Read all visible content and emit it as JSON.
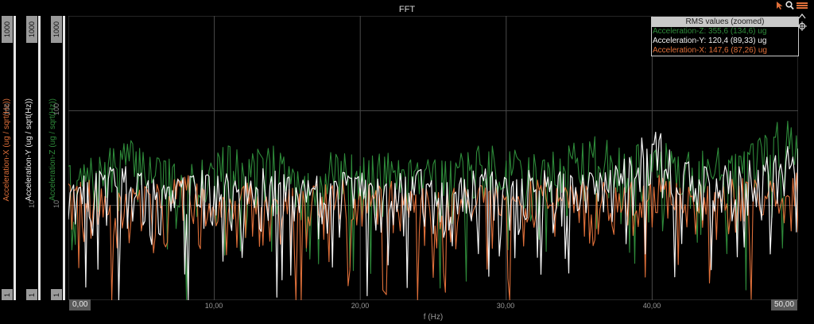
{
  "title": "FFT",
  "colors": {
    "x": "#e0703a",
    "y": "#f2f2f2",
    "z": "#2e8b3a",
    "grid": "#4a4a4a",
    "tag_bg": "#9a9a9a"
  },
  "axes": [
    {
      "id": "x",
      "label": "Acceleration-X (ug / sqrt(Hz))",
      "ticks": [
        "1000",
        "1"
      ]
    },
    {
      "id": "y",
      "label": "Acceleration-Y (ug / sqrt(Hz))",
      "ticks": [
        "1000",
        "1"
      ]
    },
    {
      "id": "z",
      "label": "Acceleration-Z (ug / sqrt(Hz))",
      "ticks": [
        "1000",
        "1"
      ]
    }
  ],
  "inner_ticks": [
    "100",
    "10"
  ],
  "xaxis": {
    "label": "f (Hz)",
    "min_label": "0,00",
    "max_label": "50,00",
    "ticks": [
      "10,00",
      "20,00",
      "30,00",
      "40,00"
    ]
  },
  "legend": {
    "header": "RMS values (zoomed)",
    "rows": [
      {
        "text": "Acceleration-Z: 355,6 (134,6) ug",
        "color": "#2e8b3a"
      },
      {
        "text": "Acceleration-Y: 120,4 (89,33) ug",
        "color": "#f2f2f2"
      },
      {
        "text": "Acceleration-X: 147,6 (87,26) ug",
        "color": "#e0703a"
      }
    ]
  },
  "toolbar": {
    "pointer_icon": "cursor-arrow-icon",
    "zoom_icon": "magnifier-icon",
    "menu_icon": "menu-icon",
    "up_icon": "chevron-up-icon",
    "crosshair_icon": "crosshair-icon"
  },
  "chart_data": {
    "type": "line",
    "title": "FFT",
    "xlabel": "f (Hz)",
    "ylabel": "",
    "xlim": [
      0,
      50
    ],
    "ylim": [
      1,
      1000
    ],
    "yscale": "log",
    "grid": true,
    "legend_position": "top-right",
    "series": [
      {
        "name": "Acceleration-Z",
        "color": "#2e8b3a",
        "x": [
          0,
          2,
          4,
          6,
          8,
          10,
          12,
          14,
          16,
          18,
          20,
          22,
          24,
          26,
          28,
          30,
          32,
          34,
          36,
          38,
          40,
          42,
          44,
          46,
          48,
          50
        ],
        "values": [
          15,
          18,
          28,
          22,
          12,
          30,
          20,
          25,
          14,
          22,
          18,
          20,
          25,
          16,
          24,
          22,
          19,
          25,
          30,
          26,
          28,
          22,
          25,
          20,
          35,
          60
        ]
      },
      {
        "name": "Acceleration-Y",
        "color": "#f2f2f2",
        "x": [
          0,
          2,
          4,
          6,
          8,
          10,
          12,
          14,
          16,
          18,
          20,
          22,
          24,
          26,
          28,
          30,
          32,
          34,
          36,
          38,
          40,
          42,
          44,
          46,
          48,
          50
        ],
        "values": [
          12,
          14,
          16,
          10,
          13,
          15,
          12,
          14,
          10,
          13,
          12,
          11,
          14,
          10,
          15,
          12,
          13,
          14,
          12,
          16,
          40,
          18,
          14,
          15,
          20,
          25
        ]
      },
      {
        "name": "Acceleration-X",
        "color": "#e0703a",
        "x": [
          0,
          2,
          4,
          6,
          8,
          10,
          12,
          14,
          16,
          18,
          20,
          22,
          24,
          26,
          28,
          30,
          32,
          34,
          36,
          38,
          40,
          42,
          44,
          46,
          48,
          50
        ],
        "values": [
          10,
          11,
          8,
          9,
          12,
          7,
          10,
          9,
          8,
          11,
          9,
          10,
          8,
          9,
          10,
          8,
          11,
          9,
          10,
          9,
          12,
          10,
          9,
          11,
          10,
          12
        ]
      }
    ]
  }
}
